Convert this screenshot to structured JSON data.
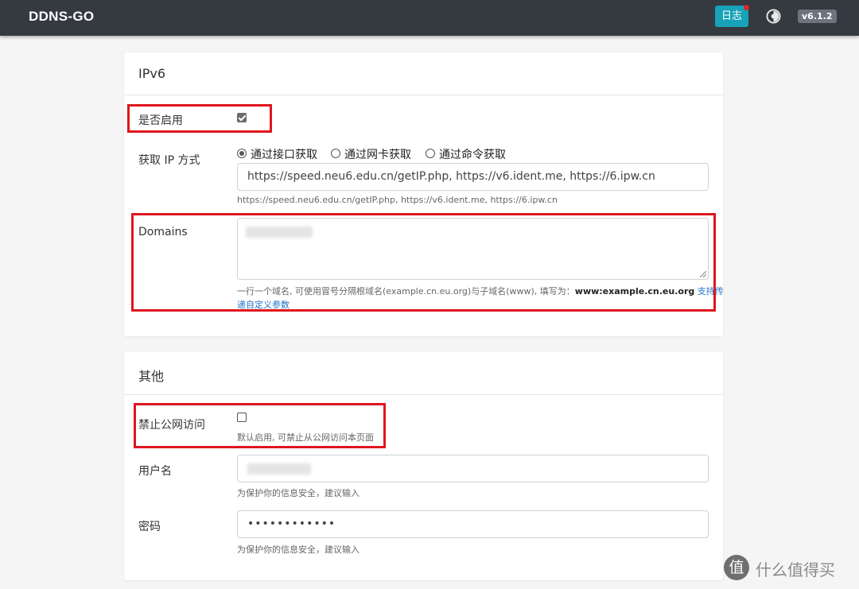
{
  "navbar": {
    "brand": "DDNS-GO",
    "log_button": "日志",
    "version": "v6.1.2"
  },
  "ipv6": {
    "title": "IPv6",
    "enable_label": "是否启用",
    "enable_checked": true,
    "get_ip_label": "获取 IP 方式",
    "options": [
      "通过接口获取",
      "通过网卡获取",
      "通过命令获取"
    ],
    "selected_option": "通过接口获取",
    "url_value": "https://speed.neu6.edu.cn/getIP.php, https://v6.ident.me, https://6.ipw.cn",
    "url_help": "https://speed.neu6.edu.cn/getIP.php, https://v6.ident.me, https://6.ipw.cn",
    "domains_label": "Domains",
    "domains_help_prefix": "一行一个域名, 可使用冒号分隔根域名(example.cn.eu.org)与子域名(www), 填写为：",
    "domains_help_example": "www:example.cn.eu.org",
    "domains_help_link_line1": "支持传",
    "domains_help_link_line2": "递自定义参数"
  },
  "other": {
    "title": "其他",
    "block_public_label": "禁止公网访问",
    "block_public_checked": false,
    "block_public_help": "默认启用, 可禁止从公网访问本页面",
    "username_label": "用户名",
    "username_help": "为保护你的信息安全，建议输入",
    "password_label": "密码",
    "password_value": "••••••••••••",
    "password_help": "为保护你的信息安全，建议输入"
  },
  "watermark": {
    "logo_char": "值",
    "text": "什么值得买"
  },
  "colors": {
    "navbar_bg": "#343a40",
    "log_button_bg": "#17a2b8",
    "version_badge_bg": "#6c757d",
    "highlight_box": "#e0161e",
    "link": "#1a73c8"
  }
}
